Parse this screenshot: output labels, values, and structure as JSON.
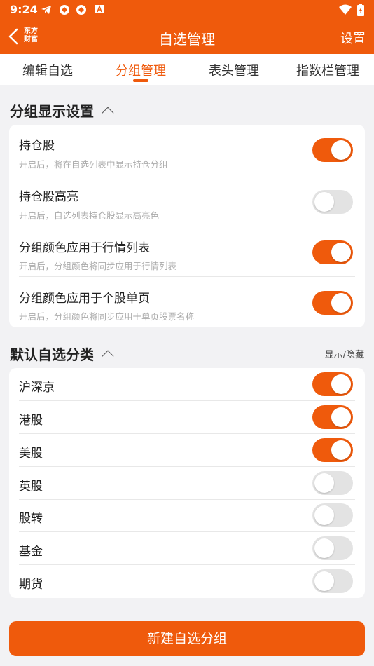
{
  "status": {
    "time": "9:24"
  },
  "header": {
    "logo_line1": "东方",
    "logo_line2": "财富",
    "title": "自选管理",
    "settings": "设置"
  },
  "tabs": [
    {
      "label": "编辑自选",
      "active": false
    },
    {
      "label": "分组管理",
      "active": true
    },
    {
      "label": "表头管理",
      "active": false
    },
    {
      "label": "指数栏管理",
      "active": false
    }
  ],
  "display_section": {
    "title": "分组显示设置",
    "rows": [
      {
        "label": "持仓股",
        "desc": "开启后，将在自选列表中显示持仓分组",
        "on": true
      },
      {
        "label": "持仓股高亮",
        "desc": "开启后，自选列表持仓股显示高亮色",
        "on": false
      },
      {
        "label": "分组颜色应用于行情列表",
        "desc": "开启后，分组颜色将同步应用于行情列表",
        "on": true
      },
      {
        "label": "分组颜色应用于个股单页",
        "desc": "开启后，分组颜色将同步应用于单页股票名称",
        "on": true
      }
    ]
  },
  "default_section": {
    "title": "默认自选分类",
    "right_label": "显示/隐藏",
    "rows": [
      {
        "label": "沪深京",
        "on": true
      },
      {
        "label": "港股",
        "on": true
      },
      {
        "label": "美股",
        "on": true
      },
      {
        "label": "英股",
        "on": false
      },
      {
        "label": "股转",
        "on": false
      },
      {
        "label": "基金",
        "on": false
      },
      {
        "label": "期货",
        "on": false
      }
    ]
  },
  "new_group_button": "新建自选分组",
  "colors": {
    "accent": "#ef5a0c",
    "toggle_off": "#e3e3e3",
    "background": "#f2f2f4"
  }
}
